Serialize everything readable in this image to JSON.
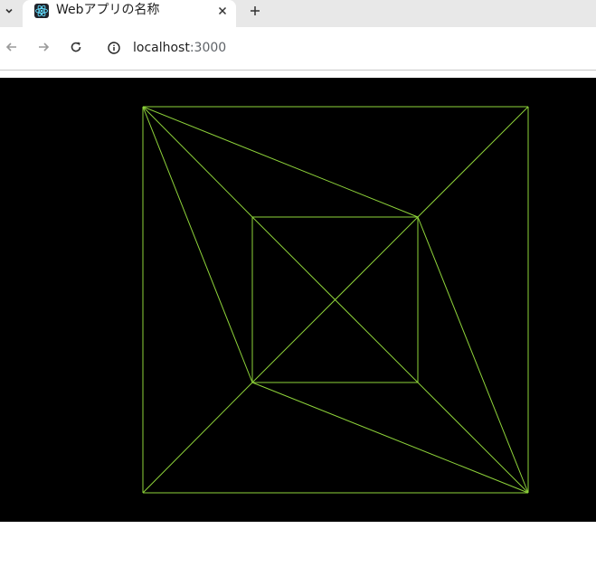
{
  "browser": {
    "tab": {
      "title": "Webアプリの名称",
      "favicon": "react-icon",
      "close_icon": "close-icon"
    },
    "new_tab_icon": "plus-icon",
    "tab_list_icon": "chevron-down-icon",
    "nav": {
      "back_icon": "arrow-left-icon",
      "forward_icon": "arrow-right-icon",
      "reload_icon": "reload-icon"
    },
    "address": {
      "info_icon": "info-icon",
      "host": "localhost",
      "port": ":3000"
    }
  },
  "page": {
    "canvas": {
      "background": "#000000",
      "stroke_color": "#8ed33a",
      "shape": "wireframe-square-pyramid"
    }
  }
}
